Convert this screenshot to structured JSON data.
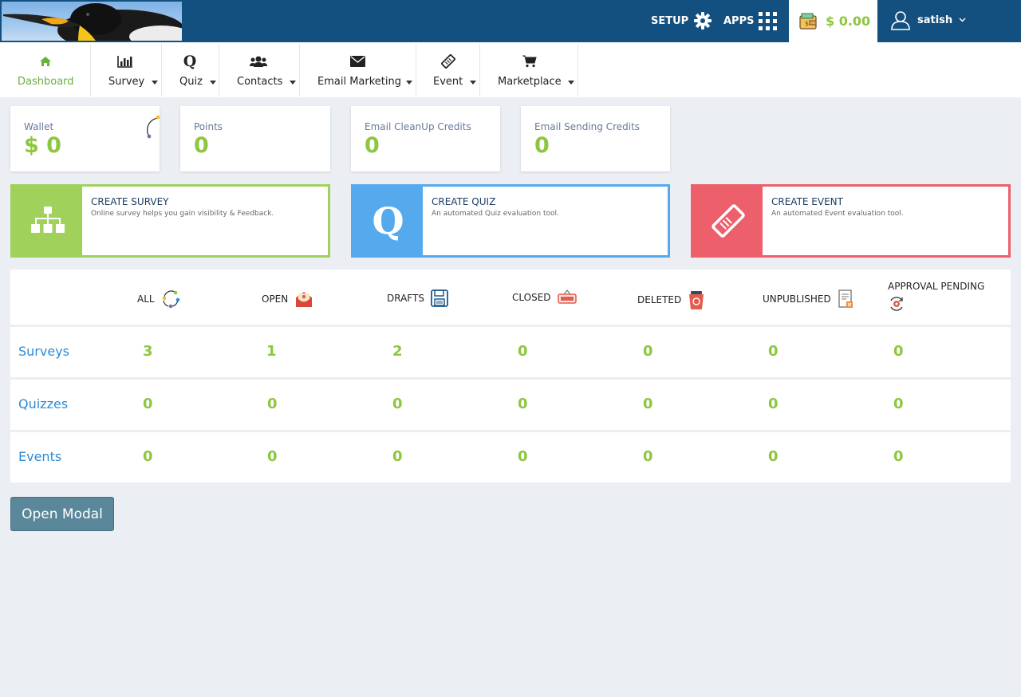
{
  "header": {
    "setup_label": "SETUP",
    "apps_label": "APPS",
    "wallet_amount": "$ 0.00",
    "username": "satish"
  },
  "nav": {
    "items": [
      {
        "label": "Dashboard",
        "icon": "home-icon",
        "active": true
      },
      {
        "label": "Survey",
        "icon": "bar-chart-icon"
      },
      {
        "label": "Quiz",
        "icon": "quiz-q-icon"
      },
      {
        "label": "Contacts",
        "icon": "users-icon"
      },
      {
        "label": "Email Marketing",
        "icon": "envelope-icon"
      },
      {
        "label": "Event",
        "icon": "ticket-icon"
      },
      {
        "label": "Marketplace",
        "icon": "cart-icon"
      }
    ]
  },
  "credits": [
    {
      "label": "Wallet",
      "value": "$ 0"
    },
    {
      "label": "Points",
      "value": "0"
    },
    {
      "label": "Email CleanUp Credits",
      "value": "0"
    },
    {
      "label": "Email Sending Credits",
      "value": "0"
    }
  ],
  "tiles": [
    {
      "title": "CREATE SURVEY",
      "desc": "Online survey helps you gain visibility & Feedback.",
      "color": "#9fd15b",
      "icon": "sitemap-icon"
    },
    {
      "title": "CREATE QUIZ",
      "desc": "An automated Quiz evaluation tool.",
      "color": "#55aaee",
      "icon": "quiz-q-icon"
    },
    {
      "title": "CREATE EVENT",
      "desc": "An automated Event evaluation tool.",
      "color": "#ec5f6b",
      "icon": "ticket-icon"
    }
  ],
  "stats": {
    "columns": [
      "ALL",
      "OPEN",
      "DRAFTS",
      "CLOSED",
      "DELETED",
      "UNPUBLISHED",
      "APPROVAL PENDING"
    ],
    "rows": [
      {
        "label": "Surveys",
        "values": [
          "3",
          "1",
          "2",
          "0",
          "0",
          "0",
          "0"
        ]
      },
      {
        "label": "Quizzes",
        "values": [
          "0",
          "0",
          "0",
          "0",
          "0",
          "0",
          "0"
        ]
      },
      {
        "label": "Events",
        "values": [
          "0",
          "0",
          "0",
          "0",
          "0",
          "0",
          "0"
        ]
      }
    ]
  },
  "open_modal_label": "Open Modal",
  "colors": {
    "header": "#13507f",
    "accent_green": "#8dc63f",
    "link_blue": "#2c8bd8"
  }
}
